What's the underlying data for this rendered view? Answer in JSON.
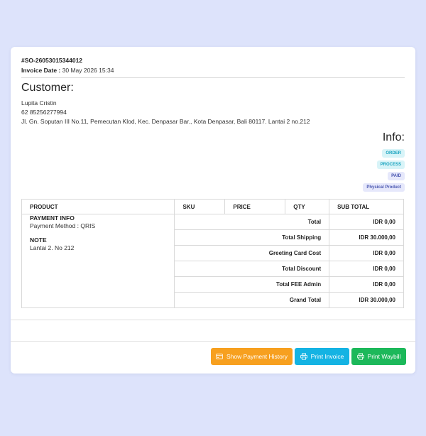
{
  "order": {
    "number": "#SO-26053015344012",
    "date_label": "Invoice Date :",
    "date_value": " 30 May 2026 15:34"
  },
  "customer": {
    "heading": "Customer:",
    "name": "Lupita Cristin",
    "phone": "62 85256277994",
    "address": "Jl. Gn. Soputan III No.11, Pemecutan Klod, Kec. Denpasar Bar., Kota Denpasar, Bali 80117. Lantai 2 no.212"
  },
  "info": {
    "heading": "Info:",
    "badges": [
      "ORDER",
      "PROCESS",
      "PAID",
      "Physical Product"
    ]
  },
  "table": {
    "headers": [
      "PRODUCT",
      "SKU",
      "PRICE",
      "QTY",
      "SUB TOTAL"
    ],
    "payment_info_title": "PAYMENT INFO",
    "payment_method": "Payment Method : QRIS",
    "note_title": "NOTE",
    "note_text": "Lantai 2. No 212",
    "summary": [
      {
        "label": "Total",
        "value": "IDR 0,00"
      },
      {
        "label": "Total Shipping",
        "value": "IDR 30.000,00"
      },
      {
        "label": "Greeting Card Cost",
        "value": "IDR 0,00"
      },
      {
        "label": "Total Discount",
        "value": "IDR 0,00"
      },
      {
        "label": "Total FEE Admin",
        "value": "IDR 0,00"
      },
      {
        "label": "Grand Total",
        "value": "IDR 30.000,00"
      }
    ]
  },
  "buttons": {
    "payment_history": "Show Payment History",
    "print_invoice": "Print Invoice",
    "print_waybill": "Print Waybill"
  },
  "colors": {
    "background": "#dde3fb",
    "orange": "#f7a01f",
    "cyan": "#14b3e3",
    "green": "#1cb85a"
  },
  "icons": {
    "payment_history": "credit-card-icon",
    "print_invoice": "printer-icon",
    "print_waybill": "printer-icon"
  }
}
